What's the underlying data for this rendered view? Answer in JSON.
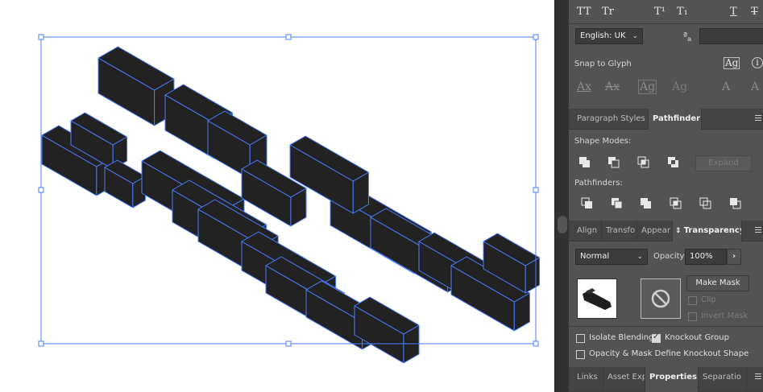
{
  "character": {
    "styles_row": [
      "TT",
      "Tr",
      "T¹",
      "T₁",
      "T",
      "T"
    ],
    "language": "English: UK",
    "aa_icon": "anti-alias-icon",
    "snap_to_glyph_label": "Snap to Glyph",
    "glyph_row": [
      "Ax",
      "Ax",
      "Ag",
      "Ag",
      "A",
      "A"
    ]
  },
  "pathfinder_tabs": {
    "paragraph_styles": "Paragraph Styles",
    "pathfinder": "Pathfinder"
  },
  "pathfinder": {
    "shape_modes_label": "Shape Modes:",
    "expand_label": "Expand",
    "pathfinders_label": "Pathfinders:"
  },
  "transparency_tabs": {
    "align": "Align",
    "transform": "Transfo",
    "appearance": "Appear",
    "transparency": "Transparency"
  },
  "transparency": {
    "blend_mode": "Normal",
    "opacity_label": "Opacity:",
    "opacity_value": "100%",
    "make_mask_label": "Make Mask",
    "clip_label": "Clip",
    "invert_mask_label": "Invert Mask",
    "isolate_blending_label": "Isolate Blending",
    "knockout_group_label": "Knockout Group",
    "opacity_mask_label": "Opacity & Mask Define Knockout Shape",
    "knockout_checked": true,
    "isolate_checked": false,
    "opacity_mask_checked": false
  },
  "bottom_tabs": {
    "links": "Links",
    "asset_export": "Asset Exp",
    "properties": "Properties",
    "separations": "Separatio"
  },
  "colors": {
    "panel_bg": "#535353",
    "selection_blue": "#4a7dff",
    "artwork_fill": "#222222"
  }
}
